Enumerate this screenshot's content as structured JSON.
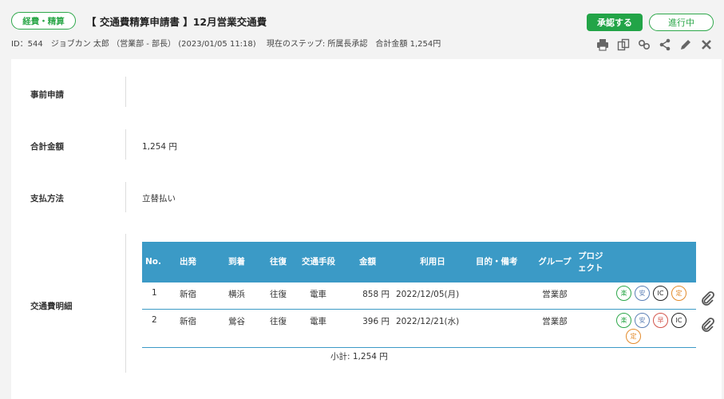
{
  "header": {
    "category": "経費・精算",
    "title": "【 交通費精算申請書 】12月営業交通費",
    "meta": "ID：544　ジョブカン 太郎 （営業部 - 部長） (2023/01/05 11:18)　 現在のステップ: 所属長承認　合計金額 1,254円",
    "approve_label": "承認する",
    "status_label": "進行中"
  },
  "fields": {
    "prior_request_label": "事前申請",
    "prior_request_value": "",
    "total_label": "合計金額",
    "total_value": "1,254 円",
    "payment_label": "支払方法",
    "payment_value": "立替払い",
    "details_label": "交通費明細"
  },
  "table": {
    "headers": {
      "no": "No.",
      "from": "出発",
      "to": "到着",
      "roundtrip": "往復",
      "means": "交通手段",
      "amount": "金額",
      "date": "利用日",
      "purpose": "目的・備考",
      "group": "グループ",
      "project": "プロジェクト"
    },
    "rows": [
      {
        "no": "1",
        "from": "新宿",
        "to": "横浜",
        "roundtrip": "往復",
        "means": "電車",
        "amount": "858 円",
        "date": "2022/12/05(月)",
        "purpose": "",
        "group": "営業部",
        "project": "",
        "badges": [
          "楽",
          "安",
          "IC",
          "定"
        ]
      },
      {
        "no": "2",
        "from": "新宿",
        "to": "鶯谷",
        "roundtrip": "往復",
        "means": "電車",
        "amount": "396 円",
        "date": "2022/12/21(水)",
        "purpose": "",
        "group": "営業部",
        "project": "",
        "badges": [
          "楽",
          "安",
          "早",
          "IC",
          "定"
        ]
      }
    ],
    "subtotal": "小計: 1,254 円"
  },
  "colors": {
    "accent_green": "#22a447",
    "table_header": "#3b9ac6"
  }
}
